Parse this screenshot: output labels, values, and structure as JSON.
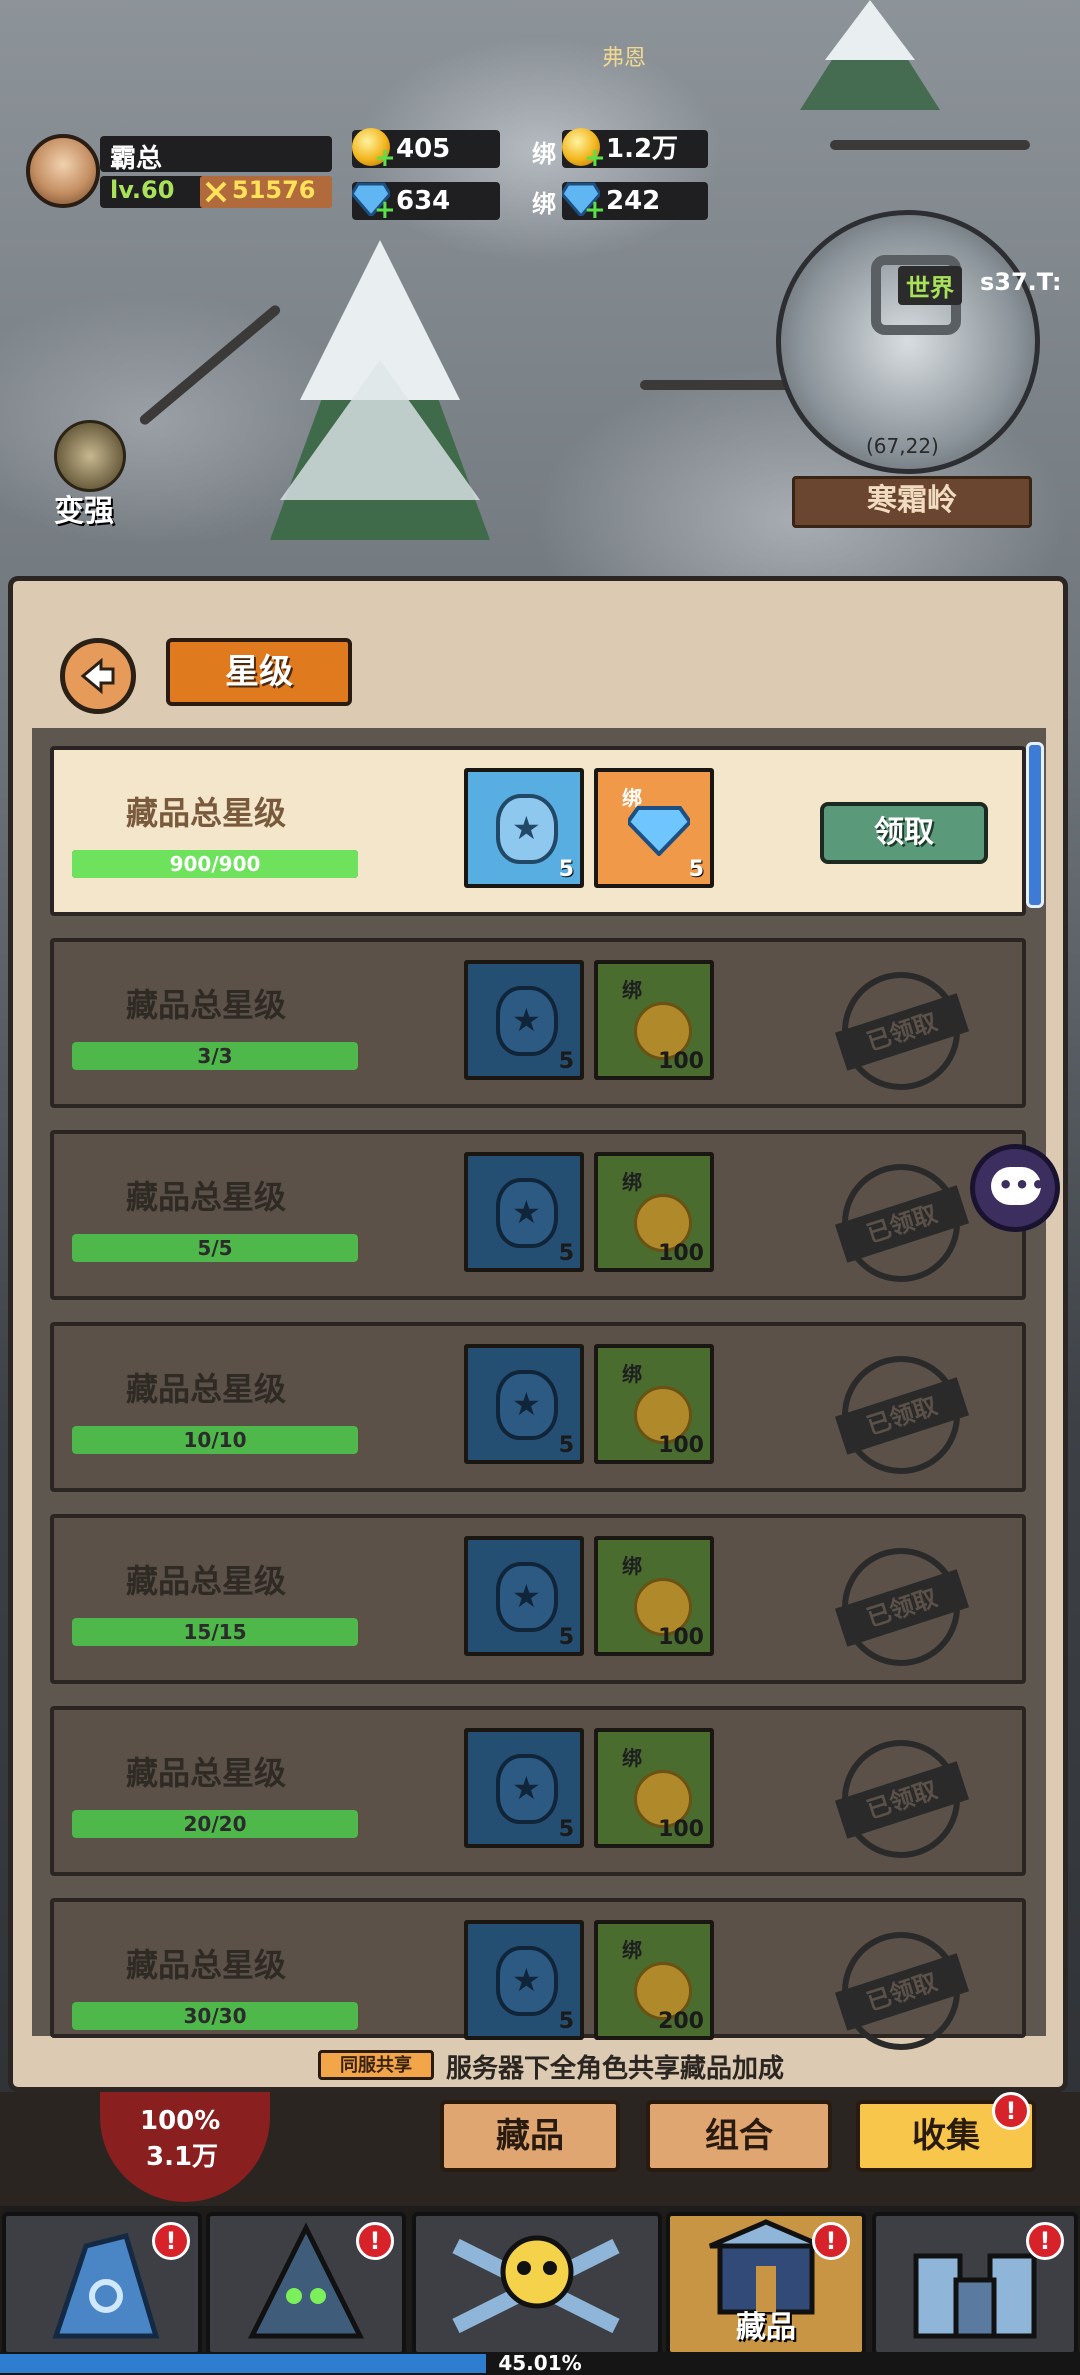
{
  "player": {
    "name": "霸总",
    "level": "lv.60",
    "power": "51576"
  },
  "resources": {
    "gold": "405",
    "gem": "634",
    "bind_label": "绑",
    "bound_gold": "1.2万",
    "bound_gem": "242"
  },
  "world": {
    "npc_name": "弗恩",
    "map_channel": "世界",
    "map_server": "s37.T:",
    "map_coords": "(67,22)",
    "map_location": "寒霜岭",
    "strengthen_label": "变强"
  },
  "panel": {
    "title_tab": "星级",
    "rows": [
      {
        "title": "藏品总星级",
        "progress": "900/900",
        "progress_fraction": 1.0,
        "reward1_qty": "5",
        "reward2_bind": "绑",
        "reward2_qty": "5",
        "status": "claimable",
        "claim_label": "领取"
      },
      {
        "title": "藏品总星级",
        "progress": "3/3",
        "progress_fraction": 1.0,
        "reward1_qty": "5",
        "reward2_bind": "绑",
        "reward2_qty": "100",
        "status": "claimed",
        "stamp_label": "已领取"
      },
      {
        "title": "藏品总星级",
        "progress": "5/5",
        "progress_fraction": 1.0,
        "reward1_qty": "5",
        "reward2_bind": "绑",
        "reward2_qty": "100",
        "status": "claimed",
        "stamp_label": "已领取"
      },
      {
        "title": "藏品总星级",
        "progress": "10/10",
        "progress_fraction": 1.0,
        "reward1_qty": "5",
        "reward2_bind": "绑",
        "reward2_qty": "100",
        "status": "claimed",
        "stamp_label": "已领取"
      },
      {
        "title": "藏品总星级",
        "progress": "15/15",
        "progress_fraction": 1.0,
        "reward1_qty": "5",
        "reward2_bind": "绑",
        "reward2_qty": "100",
        "status": "claimed",
        "stamp_label": "已领取"
      },
      {
        "title": "藏品总星级",
        "progress": "20/20",
        "progress_fraction": 1.0,
        "reward1_qty": "5",
        "reward2_bind": "绑",
        "reward2_qty": "100",
        "status": "claimed",
        "stamp_label": "已领取"
      },
      {
        "title": "藏品总星级",
        "progress": "30/30",
        "progress_fraction": 1.0,
        "reward1_qty": "5",
        "reward2_bind": "绑",
        "reward2_qty": "200",
        "status": "claimed",
        "stamp_label": "已领取"
      }
    ],
    "share_tag": "同服共享",
    "share_text": "服务器下全角色共享藏品加成"
  },
  "subtabs": {
    "hp_pct": "100%",
    "hp_val": "3.1万",
    "collection": "藏品",
    "combo": "组合",
    "gather": "收集",
    "alert_mark": "!"
  },
  "nav": {
    "selected_label": "藏品",
    "xp_percent": "45.01%",
    "xp_fraction": 0.4501
  },
  "colors": {
    "accent_orange": "#e07a1f",
    "progress_green": "#6ee25d",
    "alert_red": "#d8222a",
    "panel_bg": "#dccbb2"
  }
}
